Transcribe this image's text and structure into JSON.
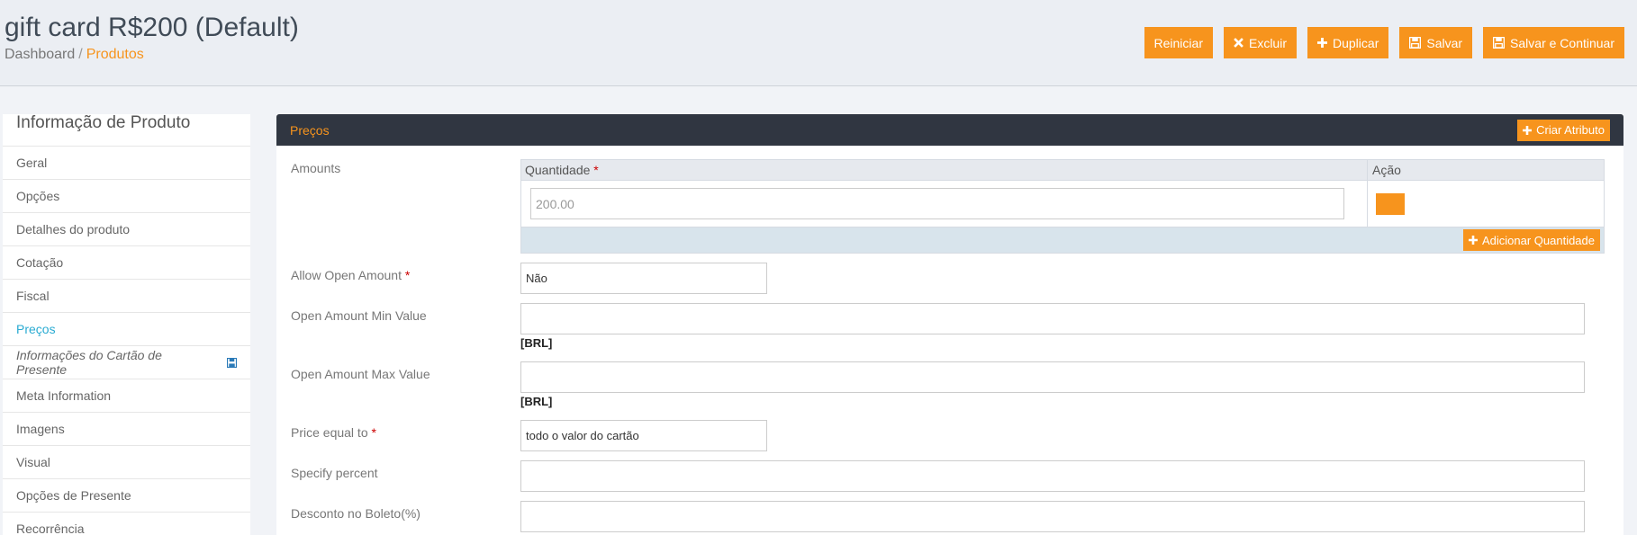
{
  "header": {
    "title": "gift card R$200 (Default)",
    "breadcrumb": {
      "home": "Dashboard",
      "separator": "/",
      "current": "Produtos"
    },
    "buttons": {
      "reset": "Reiniciar",
      "delete": "Excluir",
      "duplicate": "Duplicar",
      "save": "Salvar",
      "save_continue": "Salvar e Continuar"
    }
  },
  "sidebar": {
    "title": "Informação de Produto",
    "items": [
      {
        "label": "Geral"
      },
      {
        "label": "Opções"
      },
      {
        "label": "Detalhes do produto"
      },
      {
        "label": "Cotação"
      },
      {
        "label": "Fiscal"
      },
      {
        "label": "Preços",
        "active": true
      },
      {
        "label": "Informações do Cartão de Presente",
        "icon": "save-icon"
      },
      {
        "label": "Meta Information"
      },
      {
        "label": "Imagens"
      },
      {
        "label": "Visual"
      },
      {
        "label": "Opções de Presente"
      },
      {
        "label": "Recorrência"
      }
    ]
  },
  "panel": {
    "title": "Preços",
    "create_attribute": "Criar Atributo",
    "amounts": {
      "label": "Amounts",
      "col_quantity": "Quantidade",
      "col_action": "Ação",
      "value": "200.00",
      "add_button": "Adicionar Quantidade"
    },
    "allow_open_amount": {
      "label": "Allow Open Amount",
      "value": "Não"
    },
    "open_min": {
      "label": "Open Amount Min Value",
      "unit": "[BRL]",
      "value": ""
    },
    "open_max": {
      "label": "Open Amount Max Value",
      "unit": "[BRL]",
      "value": ""
    },
    "price_equal": {
      "label": "Price equal to",
      "value": "todo o valor do cartão"
    },
    "specify_percent": {
      "label": "Specify percent",
      "value": ""
    },
    "boleto_discount": {
      "label": "Desconto no Boleto(%)",
      "value": ""
    },
    "required_mark": "*"
  },
  "colors": {
    "accent": "#f7941d",
    "panel_header": "#303641",
    "active_link": "#2aabd2"
  }
}
